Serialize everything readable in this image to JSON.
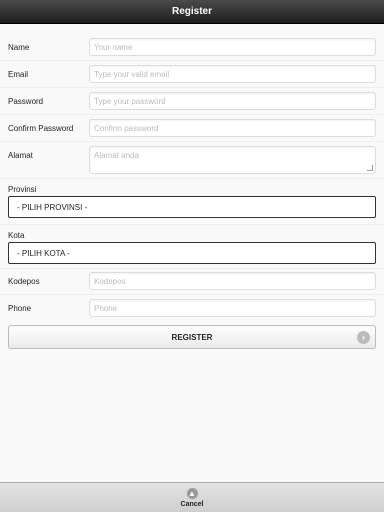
{
  "header": {
    "title": "Register"
  },
  "form": {
    "name": {
      "label": "Name",
      "placeholder": "Your name"
    },
    "email": {
      "label": "Email",
      "placeholder": "Type your valid email"
    },
    "password": {
      "label": "Password",
      "placeholder": "Type your password"
    },
    "confirm_password": {
      "label": "Confirm Password",
      "placeholder": "Confirm password"
    },
    "alamat": {
      "label": "Alamat",
      "placeholder": "Alamat anda"
    },
    "provinsi": {
      "label": "Provinsi",
      "selected": "- PILIH PROVINSI -"
    },
    "kota": {
      "label": "Kota",
      "selected": "- PILIH KOTA -"
    },
    "kodepos": {
      "label": "Kodepos",
      "placeholder": "Kodepos"
    },
    "phone": {
      "label": "Phone",
      "placeholder": "Phone"
    }
  },
  "register_button": {
    "label": "REGISTER",
    "icon": "arrow-right-icon"
  },
  "footer": {
    "cancel_label": "Cancel",
    "icon": "arrow-up-icon"
  }
}
